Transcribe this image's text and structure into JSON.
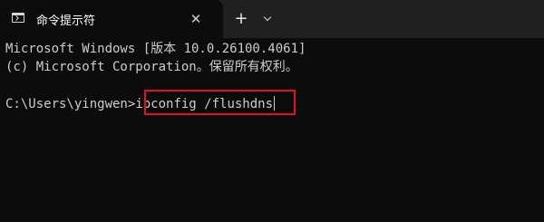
{
  "tab": {
    "title": "命令提示符",
    "icon": "terminal-icon",
    "close_label": "✕"
  },
  "toolbar": {
    "new_tab_label": "+",
    "dropdown_icon": "chevron-down-icon"
  },
  "console": {
    "line1": "Microsoft Windows [版本 10.0.26100.4061]",
    "line2": "(c) Microsoft Corporation。保留所有权利。",
    "prompt": "C:\\Users\\yingwen>",
    "command": "ipconfig /flushdns"
  },
  "colors": {
    "background": "#0c0c0c",
    "tabbar": "#202020",
    "text": "#cccccc",
    "highlight": "#e0102a"
  }
}
